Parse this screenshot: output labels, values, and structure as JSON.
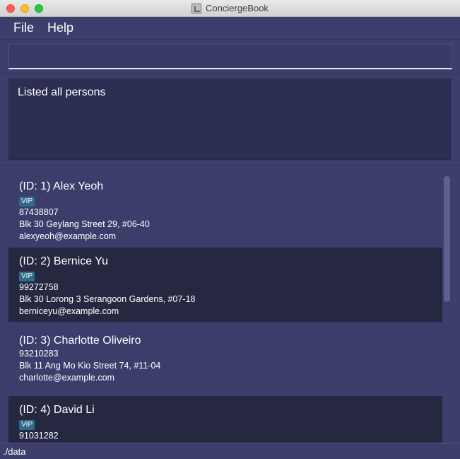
{
  "window": {
    "title": "ConciergeBook"
  },
  "menu": {
    "file": "File",
    "help": "Help"
  },
  "command": {
    "value": "",
    "placeholder": ""
  },
  "result": {
    "message": "Listed all persons"
  },
  "persons": [
    {
      "name": "(ID: 1) Alex Yeoh",
      "tag": "VIP",
      "phone": "87438807",
      "address": "Blk 30 Geylang Street 29, #06-40",
      "email": "alexyeoh@example.com"
    },
    {
      "name": "(ID: 2) Bernice Yu",
      "tag": "VIP",
      "phone": "99272758",
      "address": "Blk 30 Lorong 3 Serangoon Gardens, #07-18",
      "email": "berniceyu@example.com"
    },
    {
      "name": "(ID: 3) Charlotte Oliveiro",
      "tag": "",
      "phone": "93210283",
      "address": "Blk 11 Ang Mo Kio Street 74, #11-04",
      "email": "charlotte@example.com"
    },
    {
      "name": "(ID: 4) David Li",
      "tag": "VIP",
      "phone": "91031282",
      "address": "",
      "email": ""
    }
  ],
  "status": {
    "path": "./data"
  },
  "colors": {
    "background": "#3c3f6c",
    "card_dark": "#262842",
    "tag": "#2e6c8a"
  },
  "icons": [
    "close-button",
    "minimize-button",
    "maximize-button",
    "app-icon"
  ]
}
